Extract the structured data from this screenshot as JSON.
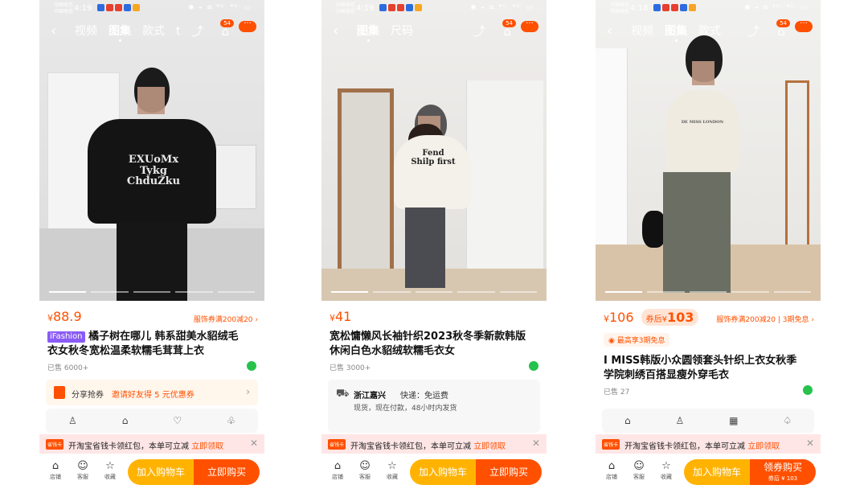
{
  "status_bar": {
    "carrier_line1": "中国电信",
    "carrier_line2": "中国电信",
    "sys_icons": "✱ ⌁ ≋ ⁴ᴳ⫶ ⁴ᴳ⫶ ▭"
  },
  "nav_common": {
    "back": "‹",
    "share": "⤴",
    "cart": "⌂",
    "cart_badge": "54",
    "more": "···"
  },
  "phones": [
    {
      "time": "4:19",
      "tabs": [
        "视频",
        "图集",
        "款式",
        "t"
      ],
      "print_text": "EXUoMx\nTykg\nChduZku",
      "price": "88.9",
      "promo": "服饰券满200减20",
      "tag": "iFashion",
      "title": "橘子树在哪儿 韩系甜美水貂绒毛衣女秋冬宽松温柔软糯毛茸茸上衣",
      "sold": "已售 6000+",
      "share_label": "分享抢券",
      "share_invite": "邀请好友得 5 元优惠券",
      "icons": [
        "♙",
        "⌂",
        "♡",
        "♧"
      ],
      "banner_tag": "省钱卡",
      "banner_msg": "开淘宝省钱卡领红包，本单可立减",
      "banner_cta": "立即领取",
      "shop": "店铺",
      "service": "客服",
      "fav": "收藏",
      "add_cart": "加入购物车",
      "buy": "立即购买"
    },
    {
      "time": "4:19",
      "tabs": [
        "图集",
        "尺码"
      ],
      "print_text": "Fend\nShilp first",
      "price": "41",
      "title": "宽松慵懒风长袖针织2023秋冬季新款韩版休闲白色水貂绒软糯毛衣女",
      "sold": "已售 3000+",
      "location": "浙江嘉兴",
      "shipping_fee": "快递：免运费",
      "shipping_info": "现货，现在付款，48小时内发货",
      "banner_tag": "省钱卡",
      "banner_msg": "开淘宝省钱卡领红包，本单可立减",
      "banner_cta": "立即领取",
      "shop": "店铺",
      "service": "客服",
      "fav": "收藏",
      "add_cart": "加入购物车",
      "buy": "立即购买"
    },
    {
      "time": "4:18",
      "tabs": [
        "视频",
        "图集",
        "款式"
      ],
      "print_text": "DE MISS LONDON",
      "price": "106",
      "coupon_label": "券后",
      "coupon_price": "103",
      "promo": "服饰券满200减20 | 3期免息",
      "notice": "最高享3期免息",
      "title": "I MISS韩版小众圆领套头针织上衣女秋季学院刺绣百搭显瘦外穿毛衣",
      "sold": "已售 27",
      "icons": [
        "⌂",
        "♙",
        "▦",
        "♤"
      ],
      "banner_tag": "省钱卡",
      "banner_msg": "开淘宝省钱卡领红包，本单可立减",
      "banner_cta": "立即领取",
      "shop": "店铺",
      "service": "客服",
      "fav": "收藏",
      "add_cart": "加入购物车",
      "buy": "领券购买",
      "buy_sub": "券后 ¥ 103"
    }
  ],
  "colors": {
    "accent": "#ff5000",
    "add_cart": "#ffb300",
    "banner_bg": "#ffe6e6"
  }
}
